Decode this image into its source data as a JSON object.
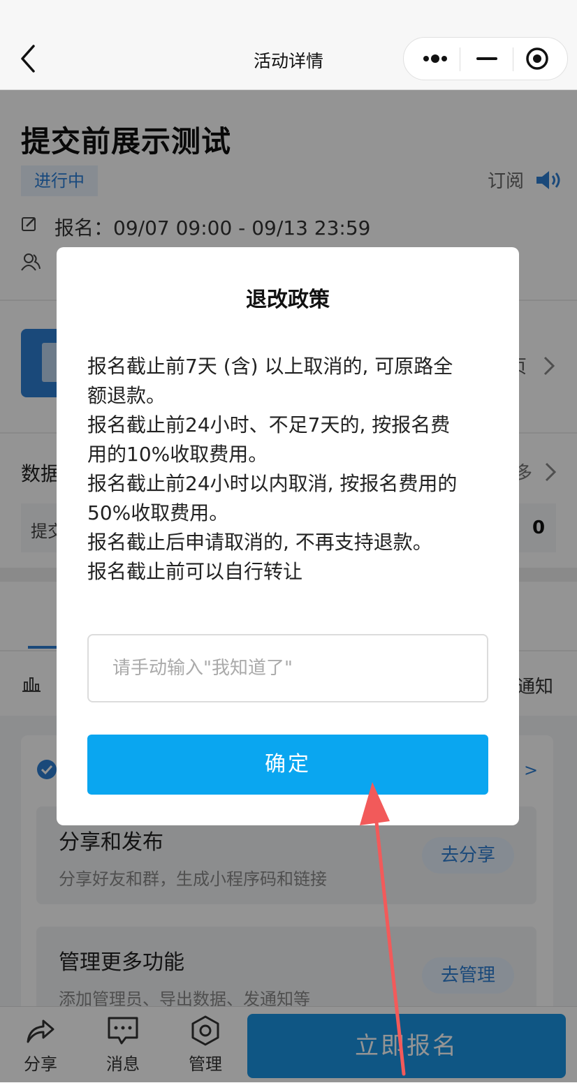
{
  "nav": {
    "title": "活动详情",
    "back_icon": "chevron-left-icon"
  },
  "activity": {
    "title": "提交前展示测试",
    "status": "进行中",
    "subscribe_label": "订阅",
    "signup_time": "报名：09/07 09:00 - 09/13 23:59",
    "page_link_fragment": "页",
    "data_label": "数据",
    "more_fragment": "多",
    "stat_label": "提交",
    "stat_value": "0",
    "notify_fragment": "通知"
  },
  "tasks": [
    {
      "title": "分享和发布",
      "desc": "分享好友和群，生成小程序码和链接",
      "button": "去分享"
    },
    {
      "title": "管理更多功能",
      "desc": "添加管理员、导出数据、发通知等",
      "button": "去管理"
    }
  ],
  "card_link": ">",
  "bottom_bar": {
    "share": "分享",
    "message": "消息",
    "manage": "管理",
    "signup": "立即报名"
  },
  "modal": {
    "title": "退改政策",
    "policy_lines": [
      "报名截止前7天 (含) 以上取消的, 可原路全",
      "额退款。",
      "报名截止前24小时、不足7天的, 按报名费",
      "用的10%收取费用。",
      "报名截止前24小时以内取消, 按报名费用的",
      "50%收取费用。",
      "报名截止后申请取消的, 不再支持退款。",
      "报名截止前可以自行转让"
    ],
    "input_placeholder": "请手动输入\"我知道了\"",
    "input_value": "",
    "confirm": "确定"
  },
  "colors": {
    "accent": "#0aa6f0",
    "brand_blue": "#2e7ed2",
    "annotation_arrow": "#f25a5a"
  }
}
